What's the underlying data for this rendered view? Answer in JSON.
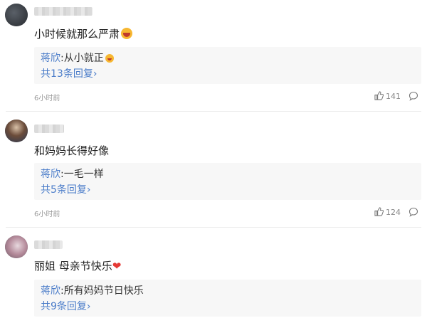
{
  "comments": [
    {
      "text": "小时候就那么严肃",
      "reply_author": "蒋欣",
      "reply_sep": ":",
      "reply_text": "从小就正",
      "reply_count": "共13条回复",
      "reply_chevron": "›",
      "time": "6小时前",
      "likes": "141",
      "emoji": "laughing-face"
    },
    {
      "text": "和妈妈长得好像",
      "reply_author": "蒋欣",
      "reply_sep": ":",
      "reply_text": "一毛一样",
      "reply_count": "共5条回复",
      "reply_chevron": "›",
      "time": "6小时前",
      "likes": "124"
    },
    {
      "text": "丽姐 母亲节快乐",
      "heart": "❤",
      "reply_author": "蒋欣",
      "reply_sep": ":",
      "reply_text": "所有妈妈节日快乐",
      "reply_count": "共9条回复",
      "reply_chevron": "›",
      "emoji": "red-heart"
    }
  ],
  "colors": {
    "link_blue": "#4a7cc9",
    "meta_gray": "#999999",
    "reply_bg": "#f7f7f7"
  },
  "icons": [
    "thumbs-up-icon",
    "comment-bubble-icon"
  ]
}
